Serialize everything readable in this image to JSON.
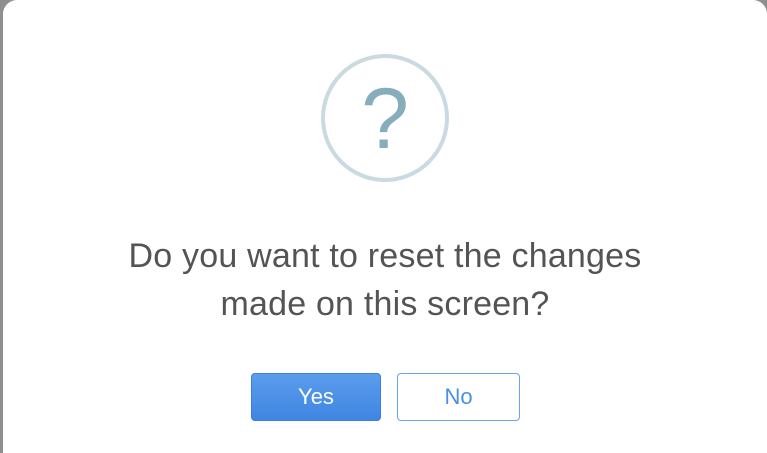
{
  "dialog": {
    "icon": "question-mark-icon",
    "icon_glyph": "?",
    "message_line1": "Do you want to reset the changes",
    "message_line2": "made on this screen?",
    "yes_label": "Yes",
    "no_label": "No"
  },
  "colors": {
    "primary": "#4a90e2",
    "icon_ring": "#c9dae1",
    "icon_glyph": "#87adbd",
    "text": "#545454"
  }
}
